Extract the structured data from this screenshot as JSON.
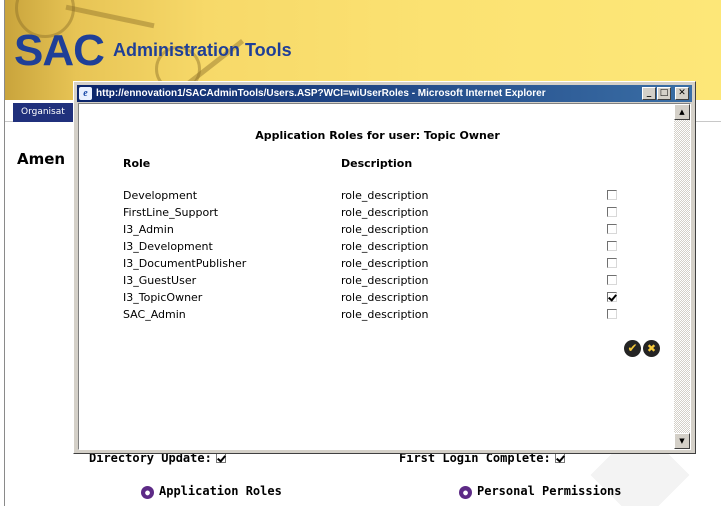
{
  "banner": {
    "logo_sac": "SAC",
    "logo_subtitle": "Administration Tools",
    "nav_tab": "Organisat",
    "colors": {
      "banner": "#f7d969",
      "logo": "#1f3f97",
      "nav_tab": "#20307c"
    }
  },
  "page": {
    "heading": "Amen",
    "directory_update_label": "Directory Update:",
    "directory_update_checked": true,
    "first_login_label": "First Login Complete:",
    "first_login_checked": true,
    "application_roles_link": "Application Roles",
    "personal_permissions_link": "Personal Permissions",
    "link_icon": "round-purple-icon"
  },
  "popup": {
    "title": "http://ennovation1/SACAdminTools/Users.ASP?WCI=wiUserRoles - Microsoft Internet Explorer",
    "heading": "Application Roles for user: Topic Owner",
    "column_role": "Role",
    "column_description": "Description",
    "roles": [
      {
        "name": "Development",
        "description": "role_description",
        "checked": false
      },
      {
        "name": "FirstLine_Support",
        "description": "role_description",
        "checked": false
      },
      {
        "name": "I3_Admin",
        "description": "role_description",
        "checked": false
      },
      {
        "name": "I3_Development",
        "description": "role_description",
        "checked": false
      },
      {
        "name": "I3_DocumentPublisher",
        "description": "role_description",
        "checked": false
      },
      {
        "name": "I3_GuestUser",
        "description": "role_description",
        "checked": false
      },
      {
        "name": "I3_TopicOwner",
        "description": "role_description",
        "checked": true
      },
      {
        "name": "SAC_Admin",
        "description": "role_description",
        "checked": false
      }
    ],
    "ok_icon": "checkmark-icon",
    "cancel_icon": "x-icon",
    "colors": {
      "titlebar_start": "#0a246a",
      "titlebar_end": "#3a6ea5",
      "action_button": "#242424",
      "action_glyph": "#f4c83a"
    }
  }
}
